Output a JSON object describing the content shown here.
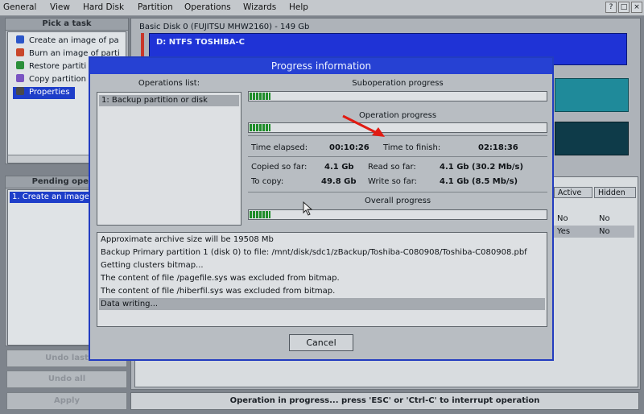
{
  "menubar": {
    "items": [
      "General",
      "View",
      "Hard Disk",
      "Partition",
      "Operations",
      "Wizards",
      "Help"
    ],
    "window_buttons": [
      "?",
      "□",
      "×"
    ]
  },
  "left_panel": {
    "title": "Pick a task",
    "tasks": [
      {
        "label": "Create an image of pa",
        "icon": "image-disk-icon",
        "color": "#2b56c9"
      },
      {
        "label": "Burn an image of parti",
        "icon": "burn-icon",
        "color": "#c9472b"
      },
      {
        "label": "Restore partiti",
        "icon": "restore-icon",
        "color": "#2b8f3a"
      },
      {
        "label": "Copy partition",
        "icon": "copy-icon",
        "color": "#7a55c2"
      },
      {
        "label": "Properties",
        "icon": "properties-icon",
        "color": "#4a4a4a"
      }
    ],
    "selected_index": 4
  },
  "pending_panel": {
    "title": "Pending operat",
    "items": [
      "1. Create an image"
    ]
  },
  "left_buttons": [
    "Undo last",
    "Undo all",
    "Apply"
  ],
  "disk": {
    "header": "Basic Disk 0 (FUJITSU MHW2160) - 149 Gb",
    "partition_label": "D: NTFS TOSHIBA-C"
  },
  "grid": {
    "columns": [
      "Active",
      "Hidden"
    ],
    "rows": [
      [
        "No",
        "No"
      ],
      [
        "Yes",
        "No"
      ]
    ]
  },
  "status": "Operation in progress... press 'ESC' or 'Ctrl-C' to interrupt operation",
  "dialog": {
    "title": "Progress information",
    "operations_list_label": "Operations list:",
    "operations": [
      "1: Backup partition or disk"
    ],
    "suboperation_label": "Suboperation progress",
    "operation_label": "Operation progress",
    "overall_label": "Overall progress",
    "suboperation_progress": 0.07,
    "operation_progress": 0.07,
    "overall_progress": 0.07,
    "time_elapsed_label": "Time elapsed:",
    "time_elapsed": "00:10:26",
    "time_to_finish_label": "Time to finish:",
    "time_to_finish": "02:18:36",
    "copied_label": "Copied so far:",
    "copied": "4.1 Gb",
    "read_label": "Read so far:",
    "read": "4.1 Gb (30.2 Mb/s)",
    "to_copy_label": "To copy:",
    "to_copy": "49.8 Gb",
    "write_label": "Write so far:",
    "write": "4.1 Gb (8.5 Mb/s)",
    "log": [
      "Approximate archive size will be 19508 Mb",
      "Backup Primary partition 1 (disk 0) to file: /mnt/disk/sdc1/zBackup/Toshiba-C080908/Toshiba-C080908.pbf",
      "Getting clusters bitmap...",
      "The content of file /pagefile.sys was excluded from bitmap.",
      "The content of file /hiberfil.sys was excluded from bitmap.",
      "Data writing..."
    ],
    "cancel_label": "Cancel"
  },
  "colors": {
    "accent": "#2641d3",
    "progress_fill": "#1f8d2a",
    "arrow": "#e11b12"
  }
}
